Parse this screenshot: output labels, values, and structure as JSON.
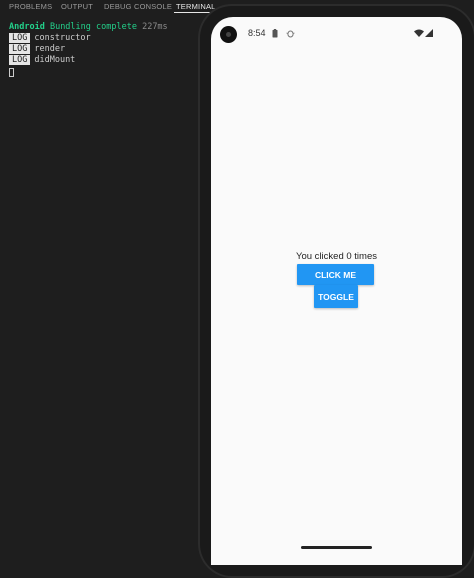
{
  "panel": {
    "tabs": [
      {
        "label": "PROBLEMS"
      },
      {
        "label": "OUTPUT"
      },
      {
        "label": "DEBUG CONSOLE"
      },
      {
        "label": "TERMINAL"
      }
    ],
    "active_tab": "TERMINAL"
  },
  "terminal": {
    "bundle": {
      "platform": "Android",
      "message": "Bundling complete",
      "time": "227ms"
    },
    "logs": [
      {
        "tag": "LOG",
        "text": "constructor"
      },
      {
        "tag": "LOG",
        "text": "render"
      },
      {
        "tag": "LOG",
        "text": "didMount"
      }
    ]
  },
  "phone": {
    "status_bar": {
      "time": "8:54",
      "icons": [
        "battery-saver-icon",
        "bug-icon",
        "wifi-icon",
        "cellular-signal-icon"
      ]
    },
    "app": {
      "count_text": "You clicked 0 times",
      "click_button_label": "CLICK ME",
      "toggle_button_label": "TOGGLE"
    }
  },
  "colors": {
    "terminal_bg": "#1e1e1e",
    "bundle_green": "#23d18b",
    "button_blue": "#2196f3",
    "screen_bg": "#fafafa"
  }
}
